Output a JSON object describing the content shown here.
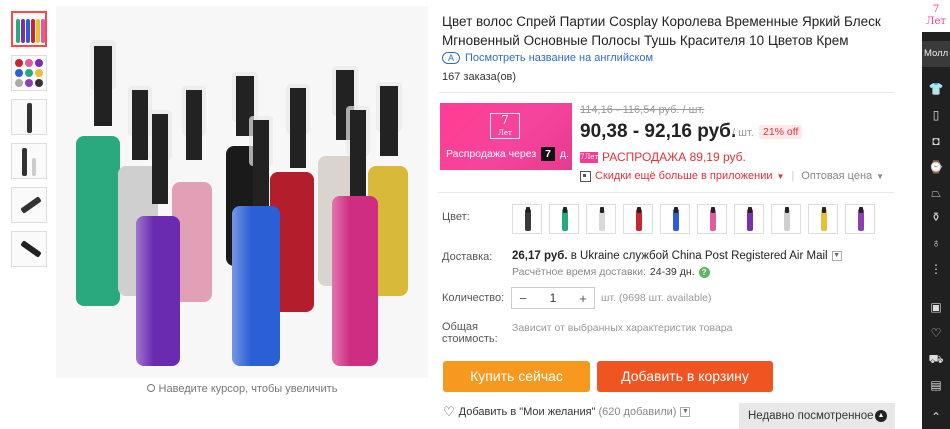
{
  "product": {
    "title": "Цвет волос Спрей Партии Cosplay Королева Временные Яркий Блеск Мгновенный Основные Полосы Тушь Красителя 10 Цветов Крем",
    "translate_link": "Посмотреть название на английском",
    "translate_icon": "ai-translate-icon",
    "orders": "167 заказа(ов)"
  },
  "gallery": {
    "zoom_hint": "Наведите курсор, чтобы увеличить"
  },
  "promo": {
    "logo_top": "7",
    "logo_bottom": "Лет",
    "sale_text": "Распродажа через",
    "days_value": "7",
    "days_suffix": "д."
  },
  "pricing": {
    "old_price": "114,16 - 116,54 руб. / шт.",
    "price": "90,38 - 92,16 руб.",
    "unit": "/ шт.",
    "discount": "21% off",
    "sale_badge": "7Лет",
    "sale_price": "РАСПРОДАЖА 89,19 руб.",
    "app_discount": "Скидки ещё больше в приложении",
    "wholesale": "Оптовая цена"
  },
  "options": {
    "color_label": "Цвет:",
    "colors": [
      "#3a3a3a",
      "#2aa87e",
      "#d9d9d9",
      "#c8262f",
      "#2b5fd6",
      "#e25aa0",
      "#7b2fa8",
      "#cfcfcf",
      "#e5c03a",
      "#8b3fb0"
    ]
  },
  "shipping": {
    "label": "Доставка:",
    "price": "26,17 руб.",
    "text": "в Ukraine службой China Post Registered Air Mail",
    "time_label": "Расчётное время доставки:",
    "time_value": "24-39 дн."
  },
  "quantity": {
    "label": "Количество:",
    "value": "1",
    "minus": "−",
    "plus": "+",
    "info": "шт. (9698 шт. available)"
  },
  "total": {
    "label_1": "Общая",
    "label_2": "стоимость:",
    "value": "Зависит от выбранных характеристик товара"
  },
  "actions": {
    "buy_now": "Купить сейчас",
    "add_to_cart": "Добавить в корзину",
    "wishlist": "Добавить в \"Мои желания\"",
    "wishlist_count": "(620 добавили)"
  },
  "recent": {
    "label": "Недавно посмотренное"
  },
  "sidebar": {
    "logo_top": "7",
    "logo_bottom": "Лет",
    "mall": "Молл",
    "icons": [
      "shirt-icon",
      "phone-icon",
      "camera-icon",
      "watch-icon",
      "shoe-icon",
      "bottle-icon",
      "ring-icon",
      "more-icon",
      "coupon-icon",
      "heart-icon",
      "cart-icon",
      "bag-icon",
      "chevron-up-icon"
    ]
  },
  "colors": {
    "accent_red": "#e8303c",
    "buy_orange": "#f7991f",
    "cart_orange": "#f05420",
    "promo_pink": "#f43c94"
  }
}
